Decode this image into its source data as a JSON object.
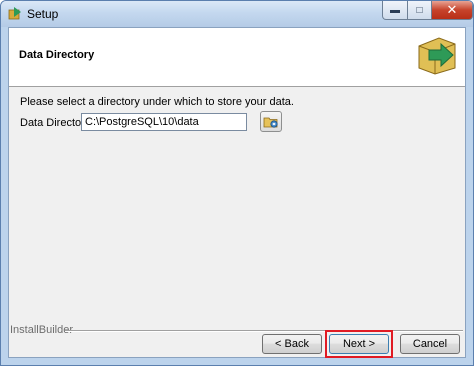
{
  "window": {
    "title": "Setup"
  },
  "header": {
    "title": "Data Directory"
  },
  "content": {
    "instruction": "Please select a directory under which to store your data.",
    "data_directory_label": "Data Directory",
    "data_directory_value": "C:\\PostgreSQL\\10\\data"
  },
  "footer": {
    "brand": "InstallBuilder",
    "back_label": "< Back",
    "next_label": "Next >",
    "cancel_label": "Cancel"
  },
  "icons": {
    "app": "installer-box-icon",
    "header": "box-arrow-icon",
    "browse": "folder-browse-icon"
  },
  "colors": {
    "highlight": "#e01b24",
    "header_icon_box": "#c9a227",
    "header_icon_arrow": "#2e9a57"
  }
}
